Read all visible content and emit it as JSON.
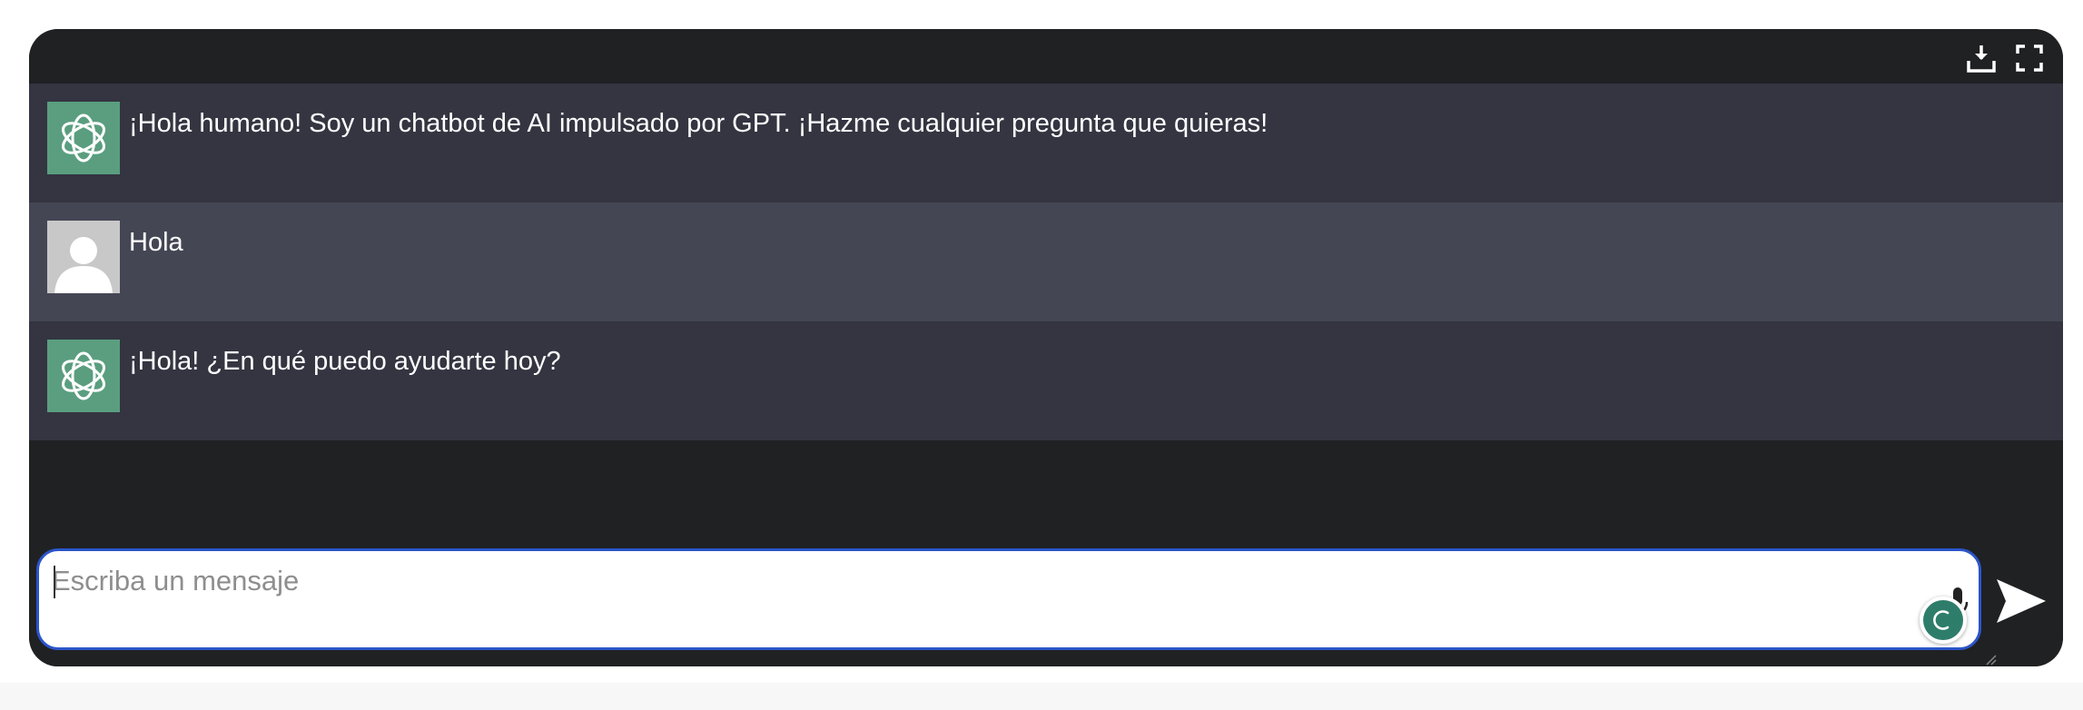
{
  "toolbar": {
    "download_icon": "download-icon",
    "fullscreen_icon": "fullscreen-icon"
  },
  "messages": [
    {
      "role": "bot",
      "text": "¡Hola humano! Soy un chatbot de AI impulsado por GPT. ¡Hazme cualquier pregunta que quieras!"
    },
    {
      "role": "user",
      "text": "Hola"
    },
    {
      "role": "bot",
      "text": "¡Hola! ¿En qué puedo ayudarte hoy?"
    }
  ],
  "composer": {
    "placeholder": "Escriba un mensaje",
    "value": ""
  },
  "colors": {
    "window_bg": "#202123",
    "bot_row_bg": "#343541",
    "user_row_bg": "#444654",
    "bot_avatar_bg": "#5a9e7f",
    "input_focus_border": "#2b55c9"
  }
}
